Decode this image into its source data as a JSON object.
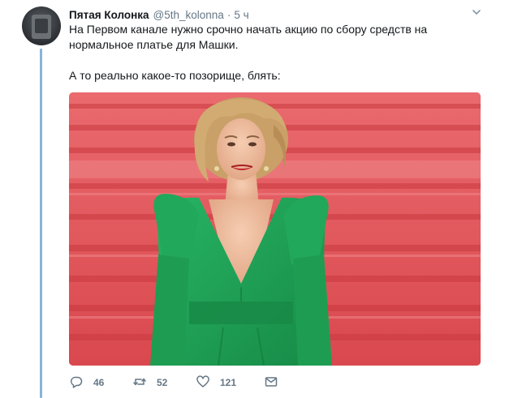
{
  "tweet": {
    "author_name": "Пятая Колонка",
    "handle": "@5th_kolonna",
    "separator": "·",
    "time": "5 ч",
    "line1": "На Первом канале нужно срочно начать акцию по сбору средств на",
    "line2": "нормальное платье для Машки.",
    "line3": "А то реально какое-то позорище, блять:"
  },
  "actions": {
    "reply_count": "46",
    "retweet_count": "52",
    "like_count": "121"
  },
  "colors": {
    "thread_line": "#8ab4d9",
    "carpet": "#e45c61",
    "dress": "#1fa356"
  },
  "icons": [
    "avatar",
    "chevron-down-icon",
    "reply-icon",
    "retweet-icon",
    "like-icon",
    "direct-message-icon"
  ]
}
